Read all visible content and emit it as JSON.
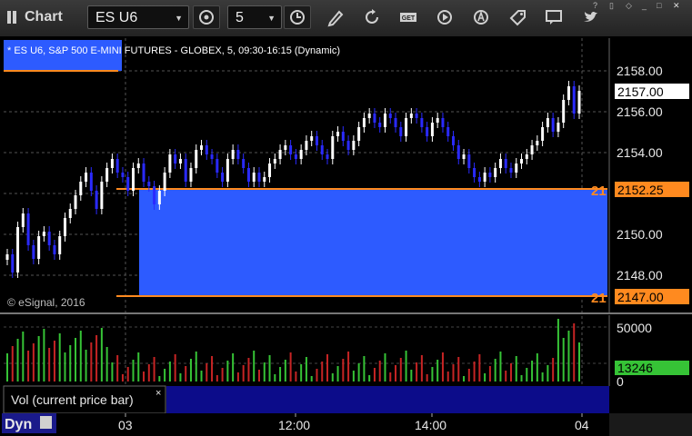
{
  "app": {
    "title": "Chart"
  },
  "toolbar": {
    "symbol": "ES U6",
    "interval": "5",
    "icons": [
      "gear-icon",
      "clock-icon",
      "pencil-icon",
      "refresh-icon",
      "get-icon",
      "play-icon",
      "alert-icon",
      "tag-icon",
      "comment-icon",
      "twitter-icon"
    ]
  },
  "chart": {
    "header": "* ES U6, S&P 500 E-MINI FUTURES - GLOBEX, 5, 09:30-16:15 (Dynamic)",
    "copyright": "© eSignal, 2016",
    "volume_label": "Vol (current price bar)",
    "close_x": "×",
    "dyn_label": "Dyn",
    "price_axis": [
      "2158.00",
      "2156.00",
      "2154.00",
      "2150.00",
      "2148.00"
    ],
    "price_tag_last": "2157.00",
    "price_tag_upper": "2152.25",
    "price_tag_lower": "2147.00",
    "truncated_upper": "21",
    "truncated_lower": "21",
    "volume_axis_top": "50000",
    "volume_axis_bottom": "0",
    "volume_value": "13246",
    "time_axis": [
      "03",
      "12:00",
      "14:00",
      "04"
    ],
    "colors": {
      "up": "#ffffff",
      "down": "#2a2aff",
      "band": "#2d5bff",
      "line": "#ff8a1f",
      "vol_up": "#36c336",
      "vol_down": "#c62424"
    }
  }
}
